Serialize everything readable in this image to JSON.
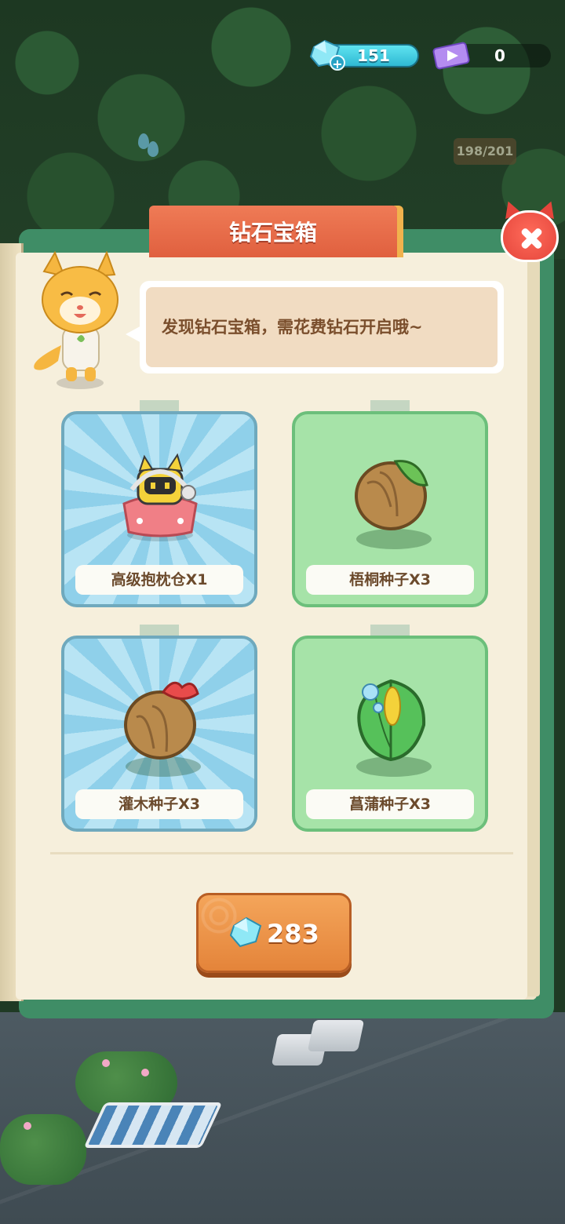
{
  "hud": {
    "gems": "151",
    "tickets": "0",
    "sign": "198/201"
  },
  "dialog": {
    "title": "钻石宝箱",
    "message": "发现钻石宝箱，需花费钻石开启哦~",
    "price": "283",
    "accent_color": "#e0603f",
    "frame_color": "#3f8d66"
  },
  "rewards": [
    {
      "label": "高级抱枕仓X1",
      "icon": "pillow-pod-icon",
      "bg": "blue"
    },
    {
      "label": "梧桐种子X3",
      "icon": "wutong-seed-icon",
      "bg": "green"
    },
    {
      "label": "灌木种子X3",
      "icon": "shrub-seed-icon",
      "bg": "blue"
    },
    {
      "label": "菖蒲种子X3",
      "icon": "calamus-seed-icon",
      "bg": "green"
    }
  ]
}
